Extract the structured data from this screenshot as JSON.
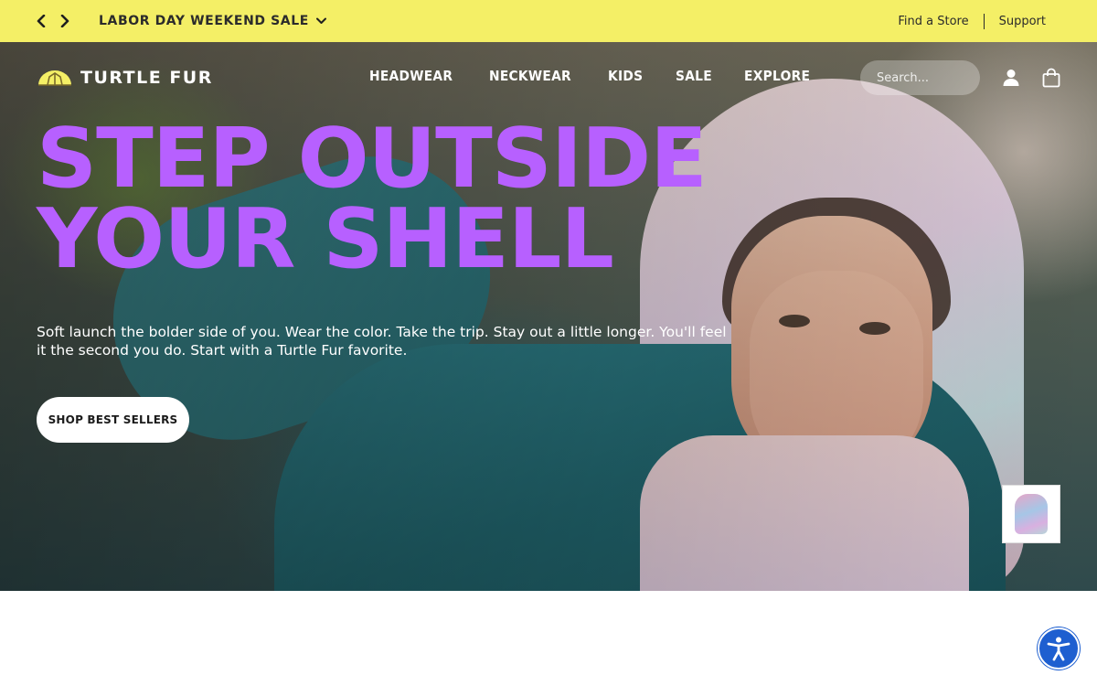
{
  "announcement": {
    "sale_label": "LABOR DAY WEEKEND SALE",
    "links": [
      "Find a Store",
      "Support"
    ]
  },
  "header": {
    "logo_text": "TURTLE FUR",
    "nav": [
      "HEADWEAR",
      "NECKWEAR",
      "KIDS",
      "SALE",
      "EXPLORE"
    ],
    "search_placeholder": "Search..."
  },
  "hero": {
    "headline_line1": "STEP OUTSIDE",
    "headline_line2": "YOUR SHELL",
    "subcopy": "Soft launch the bolder side of you. Wear the color. Take the trip. Stay out a little longer. You'll feel it the second you do. Start with a Turtle Fur favorite.",
    "cta_label": "SHOP BEST SELLERS"
  },
  "colors": {
    "announcement_bg": "#f4ef66",
    "headline": "#b760ff",
    "accessibility_button": "#1e5fd0"
  },
  "icons": [
    "chevron-left-icon",
    "chevron-right-icon",
    "chevron-down-icon",
    "turtle-fur-logo-icon",
    "account-icon",
    "shopping-bag-icon",
    "accessibility-icon"
  ]
}
